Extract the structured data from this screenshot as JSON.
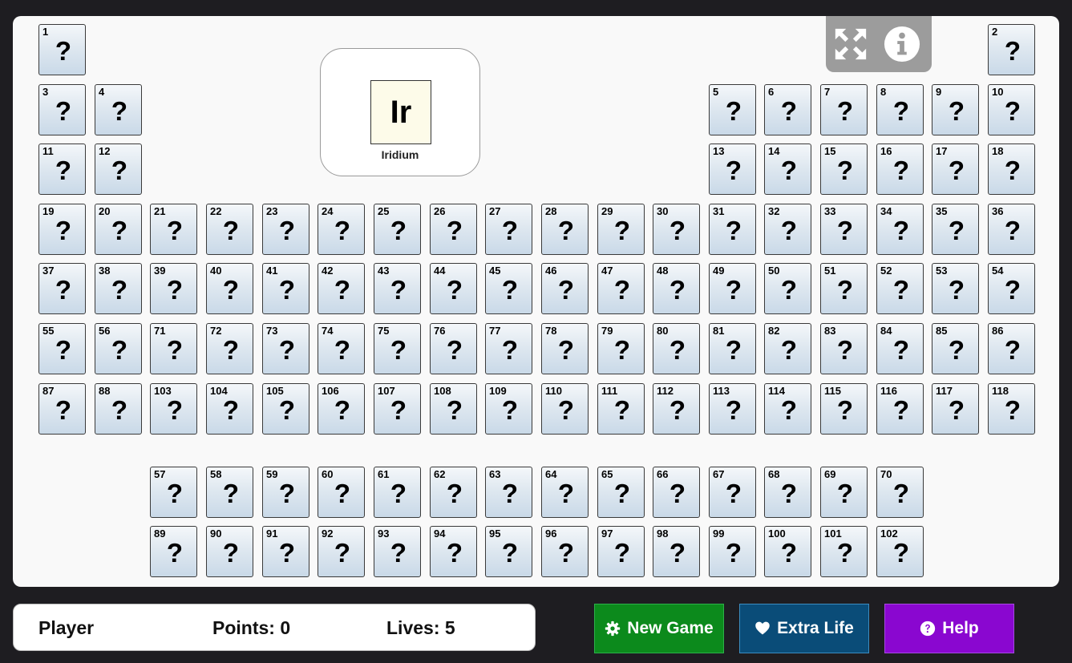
{
  "target": {
    "symbol": "Ir",
    "name": "Iridium"
  },
  "tiles": {
    "hidden_label": "?",
    "main_rows": [
      [
        1,
        null,
        null,
        null,
        null,
        null,
        null,
        null,
        null,
        null,
        null,
        null,
        null,
        null,
        null,
        null,
        null,
        2
      ],
      [
        3,
        4,
        null,
        null,
        null,
        null,
        null,
        null,
        null,
        null,
        null,
        null,
        5,
        6,
        7,
        8,
        9,
        10
      ],
      [
        11,
        12,
        null,
        null,
        null,
        null,
        null,
        null,
        null,
        null,
        null,
        null,
        13,
        14,
        15,
        16,
        17,
        18
      ],
      [
        19,
        20,
        21,
        22,
        23,
        24,
        25,
        26,
        27,
        28,
        29,
        30,
        31,
        32,
        33,
        34,
        35,
        36
      ],
      [
        37,
        38,
        39,
        40,
        41,
        42,
        43,
        44,
        45,
        46,
        47,
        48,
        49,
        50,
        51,
        52,
        53,
        54
      ],
      [
        55,
        56,
        71,
        72,
        73,
        74,
        75,
        76,
        77,
        78,
        79,
        80,
        81,
        82,
        83,
        84,
        85,
        86
      ],
      [
        87,
        88,
        103,
        104,
        105,
        106,
        107,
        108,
        109,
        110,
        111,
        112,
        113,
        114,
        115,
        116,
        117,
        118
      ]
    ],
    "f_rows": [
      [
        57,
        58,
        59,
        60,
        61,
        62,
        63,
        64,
        65,
        66,
        67,
        68,
        69,
        70
      ],
      [
        89,
        90,
        91,
        92,
        93,
        94,
        95,
        96,
        97,
        98,
        99,
        100,
        101,
        102
      ]
    ]
  },
  "toolbar": {
    "expand_icon": "expand-arrows-icon",
    "info_icon": "info-circle-icon"
  },
  "status": {
    "player": "Player",
    "points": "Points: 0",
    "lives": "Lives: 5"
  },
  "buttons": {
    "new_game": "New Game",
    "new_game_icon": "gear-icon",
    "extra_life": "Extra Life",
    "extra_life_icon": "heart-icon",
    "help": "Help",
    "help_icon": "question-circle-icon"
  },
  "colors": {
    "background": "#1e1d21",
    "board": "#f9f9f9",
    "new_game": "#0c8a1c",
    "extra_life": "#0a4c78",
    "help": "#8a07d0",
    "target_symbol_bg": "#fdfbe9"
  }
}
